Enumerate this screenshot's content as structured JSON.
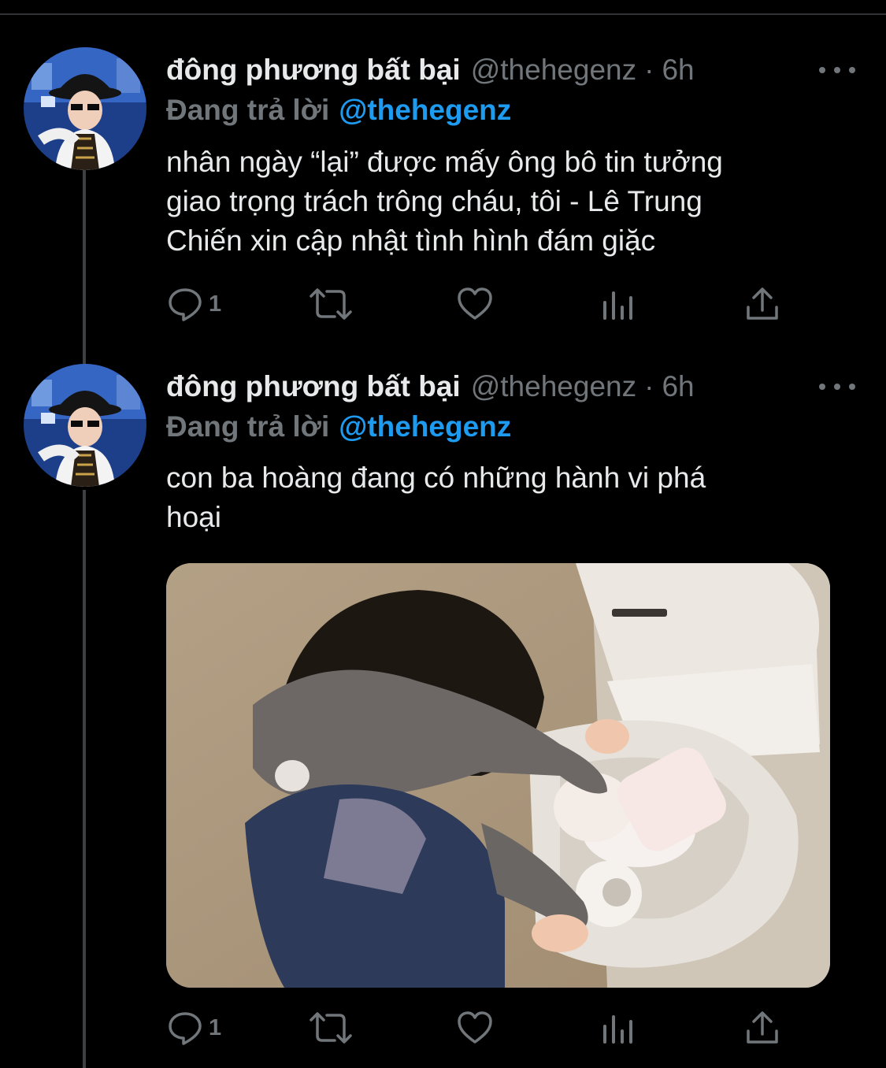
{
  "tweets": [
    {
      "author_name": "đông phương bất bại",
      "handle": "@thehegenz",
      "separator": "·",
      "time": "6h",
      "replying_label": "Đang trả lời",
      "replying_to": "@thehegenz",
      "text_lines": [
        "nhân ngày “lại” được mấy ông bô tin tưởng",
        "giao trọng trách trông cháu, tôi - Lê Trung",
        "Chiến xin cập nhật tình hình đám giặc"
      ],
      "reply_count": "1",
      "icons": [
        "reply-icon",
        "retweet-icon",
        "like-icon",
        "analytics-icon",
        "share-icon",
        "more-icon"
      ]
    },
    {
      "author_name": "đông phương bất bại",
      "handle": "@thehegenz",
      "separator": "·",
      "time": "6h",
      "replying_label": "Đang trả lời",
      "replying_to": "@thehegenz",
      "text_lines": [
        "con ba hoàng đang có những hành vi phá",
        "hoại"
      ],
      "reply_count": "1",
      "has_photo": true,
      "icons": [
        "reply-icon",
        "retweet-icon",
        "like-icon",
        "analytics-icon",
        "share-icon",
        "more-icon"
      ]
    }
  ],
  "colors": {
    "background": "#000000",
    "text": "#e7e9ea",
    "muted": "#71767b",
    "link": "#1d9bf0",
    "thread_line": "#3e4144"
  }
}
